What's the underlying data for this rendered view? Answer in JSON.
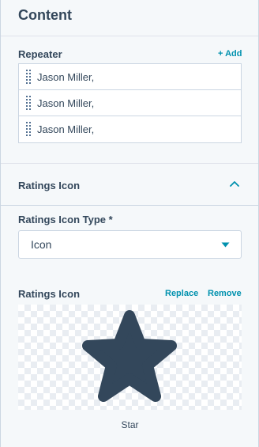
{
  "panel": {
    "title": "Content"
  },
  "repeater": {
    "label": "Repeater",
    "add_label": "+ Add",
    "items": [
      {
        "label": "Jason Miller,"
      },
      {
        "label": "Jason Miller,"
      },
      {
        "label": "Jason Miller,"
      }
    ]
  },
  "ratings_section": {
    "title": "Ratings Icon",
    "icon": "chevron-up-icon"
  },
  "icon_type": {
    "label": "Ratings Icon Type *",
    "value": "Icon",
    "icon": "caret-down-icon"
  },
  "ratings_icon": {
    "label": "Ratings Icon",
    "replace_label": "Replace",
    "remove_label": "Remove",
    "icon": "star-icon",
    "caption": "Star"
  },
  "colors": {
    "accent": "#0091ae",
    "text": "#33475b",
    "star": "#33475b",
    "border": "#cbd6e2",
    "background": "#f5f8fa"
  }
}
